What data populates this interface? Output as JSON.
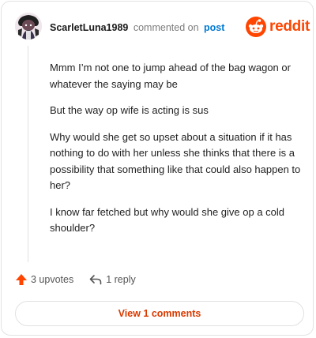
{
  "comment": {
    "author": "ScarletLuna1989",
    "action_text": "commented on",
    "post_link_label": "post",
    "body": [
      "Mmm I’m not one to jump ahead of the bag wagon or whatever the saying may be",
      "But the way op wife is acting is sus",
      "Why would she get so upset about a situation if it has nothing to do with her unless she thinks that there is a possibility that something like that could also happen to her?",
      "I know far fetched but why would she give op a cold shoulder?"
    ],
    "upvotes_label": "3 upvotes",
    "replies_label": "1 reply"
  },
  "brand": {
    "name": "reddit",
    "color": "#ff4500"
  },
  "footer": {
    "view_comments_label": "View 1 comments"
  },
  "colors": {
    "accent": "#ff4500",
    "link": "#0079d3",
    "button_text": "#d93a00"
  },
  "icons": {
    "upvote": "upvote-arrow-icon",
    "reply": "reply-arrow-icon",
    "logo": "reddit-snoo-icon"
  }
}
